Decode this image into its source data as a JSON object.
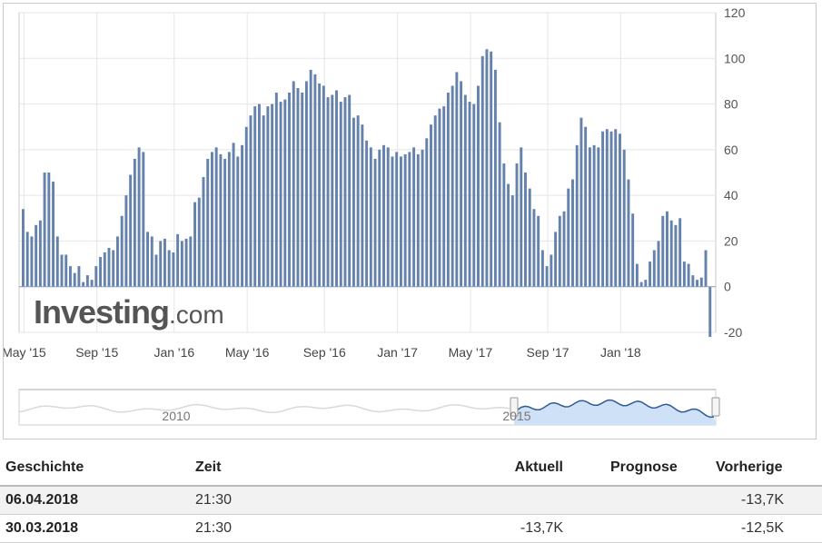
{
  "chart_data": {
    "type": "bar",
    "title": "",
    "xlabel": "",
    "ylabel": "",
    "ylim": [
      -20,
      120
    ],
    "yticks": [
      120,
      100,
      80,
      60,
      40,
      20,
      0,
      -20
    ],
    "xtick_labels": [
      "May '15",
      "Sep '15",
      "Jan '16",
      "May '16",
      "Sep '16",
      "Jan '17",
      "May '17",
      "Sep '17",
      "Jan '18"
    ],
    "values": [
      34,
      24,
      22,
      27,
      29,
      50,
      50,
      46,
      22,
      14,
      14,
      9,
      6,
      9,
      2,
      5,
      3,
      9,
      13,
      15,
      17,
      16,
      22,
      31,
      40,
      49,
      56,
      61,
      59,
      24,
      22,
      14,
      20,
      21,
      16,
      15,
      23,
      20,
      21,
      22,
      37,
      39,
      48,
      56,
      59,
      61,
      58,
      56,
      59,
      63,
      57,
      62,
      70,
      75,
      79,
      80,
      75,
      79,
      80,
      85,
      81,
      82,
      85,
      90,
      87,
      85,
      90,
      95,
      93,
      89,
      88,
      83,
      84,
      86,
      81,
      83,
      84,
      74,
      75,
      71,
      64,
      61,
      56,
      60,
      62,
      61,
      57,
      59,
      57,
      58,
      59,
      61,
      58,
      60,
      65,
      71,
      75,
      78,
      79,
      85,
      88,
      94,
      90,
      84,
      81,
      80,
      88,
      101,
      104,
      103,
      95,
      72,
      54,
      45,
      40,
      54,
      61,
      50,
      43,
      34,
      31,
      16,
      9,
      14,
      24,
      31,
      33,
      43,
      47,
      62,
      74,
      70,
      61,
      62,
      61,
      68,
      69,
      68,
      69,
      67,
      60,
      47,
      32,
      10,
      2,
      3,
      11,
      16,
      20,
      31,
      33,
      29,
      27,
      30,
      11,
      10,
      5,
      3,
      4,
      16,
      -22
    ],
    "highlight": {
      "colors": {
        "bar": "#6582ad",
        "axis": "#c8c8c8",
        "grid": "#e5e5e5"
      }
    }
  },
  "navigator": {
    "labels": [
      "2010",
      "2015"
    ],
    "colors": {
      "line": "#2f5a93",
      "fill": "#cfe1f6",
      "history_line": "#d9d9d9"
    }
  },
  "logo": {
    "word": "Investing",
    "suffix": ".com"
  },
  "table": {
    "headers": {
      "date": "Geschichte",
      "time": "Zeit",
      "actual": "Aktuell",
      "forecast": "Prognose",
      "previous": "Vorherige"
    },
    "rows": [
      {
        "date": "06.04.2018",
        "time": "21:30",
        "actual": "",
        "forecast": "",
        "previous": "-13,7K"
      },
      {
        "date": "30.03.2018",
        "time": "21:30",
        "actual": "-13,7K",
        "forecast": "",
        "previous": "-12,5K"
      }
    ]
  }
}
